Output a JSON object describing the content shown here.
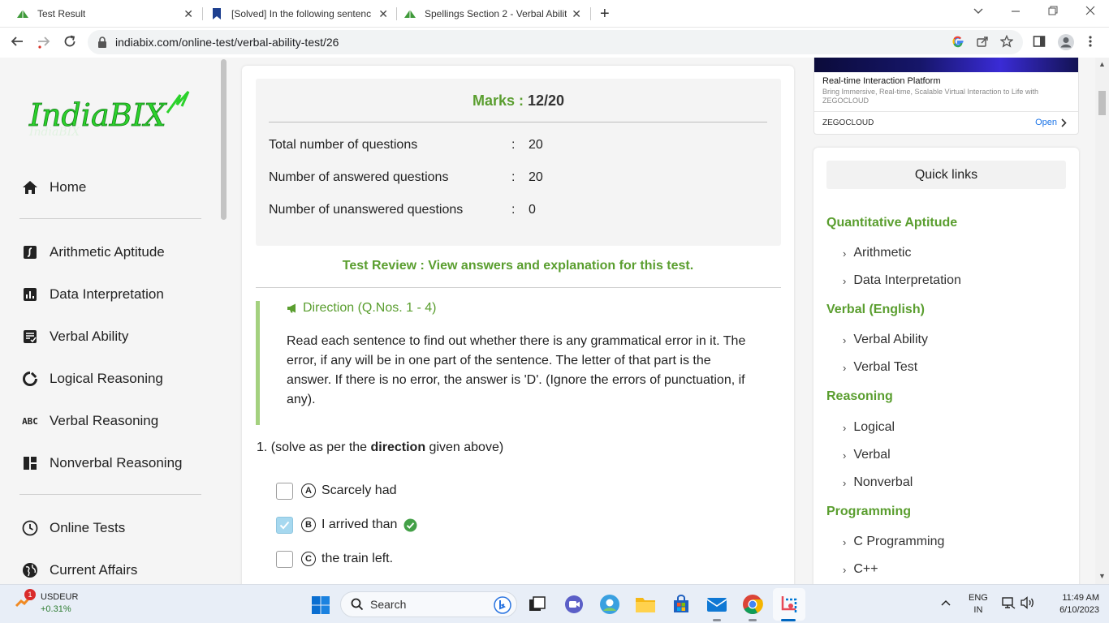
{
  "browser": {
    "tabs": [
      {
        "title": "Test Result",
        "close": "✕"
      },
      {
        "title": "[Solved] In the following sentenc",
        "close": "✕"
      },
      {
        "title": "Spellings Section 2 - Verbal Abilit",
        "close": "✕"
      }
    ],
    "new_tab": "+",
    "url": "indiabix.com/online-test/verbal-ability-test/26"
  },
  "sidebar": {
    "logo_text": "IndiaBIX",
    "items": [
      {
        "label": "Home",
        "icon": "home-icon"
      },
      {
        "label": "Arithmetic Aptitude",
        "icon": "arithmetic-icon"
      },
      {
        "label": "Data Interpretation",
        "icon": "bar-chart-icon"
      },
      {
        "label": "Verbal Ability",
        "icon": "verbal-ability-icon"
      },
      {
        "label": "Logical Reasoning",
        "icon": "logical-icon"
      },
      {
        "label": "Verbal Reasoning",
        "icon": "abc-icon",
        "icon_text": "ABC"
      },
      {
        "label": "Nonverbal Reasoning",
        "icon": "nonverbal-icon"
      },
      {
        "label": "Online Tests",
        "icon": "clock-icon"
      },
      {
        "label": "Current Affairs",
        "icon": "globe-icon"
      }
    ]
  },
  "result": {
    "marks_label": "Marks :",
    "marks_value": "12/20",
    "rows": [
      {
        "label": "Total number of questions",
        "sep": ":",
        "value": "20"
      },
      {
        "label": "Number of answered questions",
        "sep": ":",
        "value": "20"
      },
      {
        "label": "Number of unanswered questions",
        "sep": ":",
        "value": "0"
      }
    ],
    "review_link": "Test Review : View answers and explanation for this test."
  },
  "direction": {
    "title": "Direction (Q.Nos. 1 - 4)",
    "text": "Read each sentence to find out whether there is any grammatical error in it. The error, if any will be in one part of the sentence. The letter of that part is the answer. If there is no error, the answer is 'D'. (Ignore the errors of punctuation, if any)."
  },
  "question": {
    "number": "1.",
    "prefix": "(solve as per the",
    "bold": "direction",
    "suffix": "given above)",
    "options": [
      {
        "letter": "A",
        "text": "Scarcely had",
        "checked": false,
        "correct": false
      },
      {
        "letter": "B",
        "text": "I arrived than",
        "checked": true,
        "correct": true
      },
      {
        "letter": "C",
        "text": "the train left.",
        "checked": false,
        "correct": false
      }
    ]
  },
  "ad": {
    "title": "Real-time Interaction Platform",
    "desc": "Bring Immersive, Real-time, Scalable Virtual Interaction to Life with ZEGOCLOUD",
    "brand": "ZEGOCLOUD",
    "open": "Open"
  },
  "quick_links": {
    "heading": "Quick links",
    "sections": [
      {
        "title": "Quantitative Aptitude",
        "items": [
          "Arithmetic",
          "Data Interpretation"
        ]
      },
      {
        "title": "Verbal (English)",
        "items": [
          "Verbal Ability",
          "Verbal Test"
        ]
      },
      {
        "title": "Reasoning",
        "items": [
          "Logical",
          "Verbal",
          "Nonverbal"
        ]
      },
      {
        "title": "Programming",
        "items": [
          "C Programming",
          "C++"
        ]
      }
    ]
  },
  "taskbar": {
    "ticker": "USDEUR",
    "ticker_change": "+0.31%",
    "badge": "1",
    "search": "Search",
    "lang_1": "ENG",
    "lang_2": "IN",
    "time": "11:49 AM",
    "date": "6/10/2023"
  },
  "colors": {
    "accent_green": "#5a9e2f",
    "direction_border": "#a4d17f",
    "checked_box": "#a6d8ef",
    "correct_icon": "#43a047"
  }
}
